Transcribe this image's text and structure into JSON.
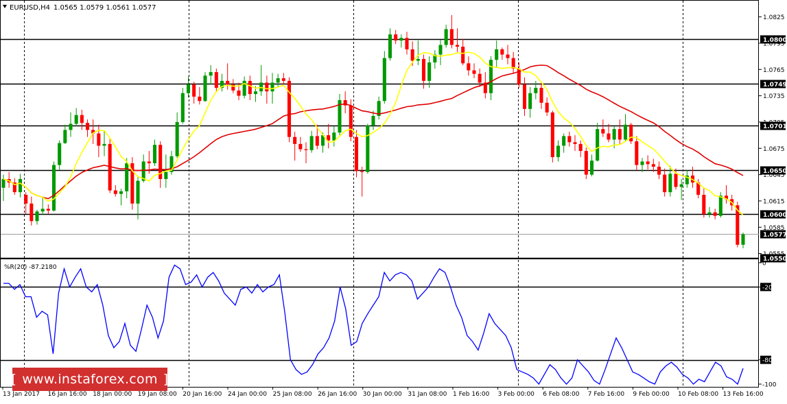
{
  "header": {
    "symbol": "EURUSD,H4",
    "ohlc": "1.0565 1.0579 1.0561 1.0577",
    "menu_icon": "triangle-down-icon"
  },
  "indicator": {
    "label": "%R(20) -87.2180"
  },
  "price_axis": {
    "ticks": [
      "1.0825",
      "1.0795",
      "1.0765",
      "1.0735",
      "1.0705",
      "1.0675",
      "1.0645",
      "1.0615",
      "1.0585",
      "1.0555"
    ],
    "levels": [
      {
        "label": "1.0800",
        "value": 1.08
      },
      {
        "label": "1.0749",
        "value": 1.0749
      },
      {
        "label": "1.0701",
        "value": 1.0701
      },
      {
        "label": "1.0650",
        "value": 1.065
      },
      {
        "label": "1.0600",
        "value": 1.06
      },
      {
        "label": "1.0577",
        "value": 1.0577
      },
      {
        "label": "1.0550",
        "value": 1.055
      }
    ]
  },
  "indicator_axis": {
    "ticks": [
      "0",
      "-20",
      "-80",
      "-100"
    ]
  },
  "time_axis": {
    "labels": [
      "13 Jan 2017",
      "16 Jan 16:00",
      "18 Jan 00:00",
      "19 Jan 08:00",
      "20 Jan 16:00",
      "24 Jan 00:00",
      "25 Jan 08:00",
      "26 Jan 16:00",
      "30 Jan 00:00",
      "31 Jan 08:00",
      "1 Feb 16:00",
      "3 Feb 00:00",
      "6 Feb 08:00",
      "7 Feb 16:00",
      "9 Feb 00:00",
      "10 Feb 08:00",
      "13 Feb 16:00"
    ]
  },
  "watermark": {
    "text": "www.instaforex.com",
    "left_bracket": "[",
    "right_bracket": "]"
  },
  "colors": {
    "bull": "#009900",
    "bear": "#ff0000",
    "ma_fast": "#ffff00",
    "ma_slow": "#e00000",
    "wpr": "#0000ff",
    "level_box": "#000000"
  },
  "chart_data": {
    "type": "candlestick",
    "timeframe": "H4",
    "ylim": [
      1.055,
      1.0835
    ],
    "wpr_ylim": [
      -100,
      0
    ],
    "wpr_levels": [
      -20,
      -80
    ],
    "candles": [
      [
        1.063,
        1.0645,
        1.0615,
        1.064
      ],
      [
        1.064,
        1.0648,
        1.063,
        1.0636
      ],
      [
        1.0636,
        1.0641,
        1.0622,
        1.0625
      ],
      [
        1.0625,
        1.0646,
        1.0619,
        1.064
      ],
      [
        1.0622,
        1.0625,
        1.06,
        1.0612
      ],
      [
        1.0612,
        1.062,
        1.0587,
        1.0592
      ],
      [
        1.0592,
        1.0605,
        1.0588,
        1.0603
      ],
      [
        1.0603,
        1.062,
        1.0599,
        1.0606
      ],
      [
        1.0606,
        1.0611,
        1.06,
        1.0604
      ],
      [
        1.0604,
        1.066,
        1.0603,
        1.0656
      ],
      [
        1.0656,
        1.0684,
        1.065,
        1.0681
      ],
      [
        1.0681,
        1.0702,
        1.068,
        1.0696
      ],
      [
        1.0696,
        1.0716,
        1.0688,
        1.0703
      ],
      [
        1.0703,
        1.0721,
        1.07,
        1.0713
      ],
      [
        1.0713,
        1.0719,
        1.0696,
        1.0704
      ],
      [
        1.0704,
        1.0708,
        1.0688,
        1.0696
      ],
      [
        1.0696,
        1.0708,
        1.068,
        1.0692
      ],
      [
        1.0692,
        1.0702,
        1.0665,
        1.0678
      ],
      [
        1.0678,
        1.0695,
        1.0666,
        1.068
      ],
      [
        1.068,
        1.0686,
        1.0624,
        1.0627
      ],
      [
        1.0627,
        1.0633,
        1.062,
        1.0623
      ],
      [
        1.0623,
        1.0629,
        1.061,
        1.0626
      ],
      [
        1.0626,
        1.0664,
        1.0618,
        1.0658
      ],
      [
        1.0658,
        1.0665,
        1.0605,
        1.0612
      ],
      [
        1.0612,
        1.0643,
        1.0594,
        1.0638
      ],
      [
        1.0638,
        1.0668,
        1.0636,
        1.066
      ],
      [
        1.066,
        1.0672,
        1.0646,
        1.0658
      ],
      [
        1.0658,
        1.0685,
        1.0655,
        1.0679
      ],
      [
        1.0679,
        1.0683,
        1.063,
        1.064
      ],
      [
        1.064,
        1.0668,
        1.063,
        1.0648
      ],
      [
        1.0648,
        1.0672,
        1.0645,
        1.0666
      ],
      [
        1.0666,
        1.0716,
        1.0664,
        1.0705
      ],
      [
        1.0705,
        1.0744,
        1.0703,
        1.0738
      ],
      [
        1.0738,
        1.0757,
        1.0733,
        1.0748
      ],
      [
        1.0748,
        1.0751,
        1.0726,
        1.0734
      ],
      [
        1.0734,
        1.0745,
        1.0725,
        1.0729
      ],
      [
        1.0729,
        1.0762,
        1.0728,
        1.0758
      ],
      [
        1.0758,
        1.077,
        1.0748,
        1.0762
      ],
      [
        1.0762,
        1.0766,
        1.074,
        1.0744
      ],
      [
        1.0744,
        1.076,
        1.074,
        1.0752
      ],
      [
        1.0752,
        1.0772,
        1.0742,
        1.0748
      ],
      [
        1.0748,
        1.0754,
        1.0738,
        1.0741
      ],
      [
        1.0741,
        1.075,
        1.073,
        1.0735
      ],
      [
        1.0735,
        1.0757,
        1.0732,
        1.0752
      ],
      [
        1.0752,
        1.0758,
        1.073,
        1.0737
      ],
      [
        1.0737,
        1.0746,
        1.0728,
        1.074
      ],
      [
        1.074,
        1.077,
        1.0735,
        1.075
      ],
      [
        1.075,
        1.0758,
        1.0726,
        1.074
      ],
      [
        1.074,
        1.0761,
        1.0726,
        1.075
      ],
      [
        1.075,
        1.076,
        1.0745,
        1.0755
      ],
      [
        1.0755,
        1.0761,
        1.0748,
        1.0752
      ],
      [
        1.0752,
        1.0756,
        1.0682,
        1.0688
      ],
      [
        1.0688,
        1.0694,
        1.0661,
        1.068
      ],
      [
        1.068,
        1.0688,
        1.0671,
        1.0674
      ],
      [
        1.0674,
        1.0682,
        1.0658,
        1.0673
      ],
      [
        1.0673,
        1.0695,
        1.067,
        1.0689
      ],
      [
        1.0689,
        1.0702,
        1.0674,
        1.0678
      ],
      [
        1.0678,
        1.0693,
        1.067,
        1.069
      ],
      [
        1.069,
        1.0703,
        1.0675,
        1.0684
      ],
      [
        1.0684,
        1.07,
        1.0677,
        1.0693
      ],
      [
        1.0693,
        1.0737,
        1.069,
        1.073
      ],
      [
        1.073,
        1.074,
        1.0715,
        1.0724
      ],
      [
        1.0724,
        1.0731,
        1.0683,
        1.0688
      ],
      [
        1.0688,
        1.0696,
        1.0642,
        1.0649
      ],
      [
        1.0649,
        1.0654,
        1.062,
        1.0648
      ],
      [
        1.0648,
        1.0703,
        1.0646,
        1.0701
      ],
      [
        1.0701,
        1.0718,
        1.0696,
        1.0712
      ],
      [
        1.0712,
        1.0734,
        1.0708,
        1.0729
      ],
      [
        1.0729,
        1.0786,
        1.0726,
        1.0778
      ],
      [
        1.0778,
        1.0812,
        1.0775,
        1.0805
      ],
      [
        1.0805,
        1.081,
        1.0794,
        1.0798
      ],
      [
        1.0798,
        1.0805,
        1.079,
        1.0801
      ],
      [
        1.0801,
        1.0808,
        1.0782,
        1.0788
      ],
      [
        1.0788,
        1.0797,
        1.0769,
        1.0775
      ],
      [
        1.0775,
        1.0798,
        1.077,
        1.0777
      ],
      [
        1.0777,
        1.0782,
        1.0743,
        1.0752
      ],
      [
        1.0752,
        1.078,
        1.0744,
        1.0773
      ],
      [
        1.0773,
        1.0787,
        1.0766,
        1.0782
      ],
      [
        1.0782,
        1.0799,
        1.077,
        1.0793
      ],
      [
        1.0793,
        1.0816,
        1.079,
        1.0811
      ],
      [
        1.0811,
        1.0827,
        1.0789,
        1.0793
      ],
      [
        1.0793,
        1.0812,
        1.0785,
        1.0791
      ],
      [
        1.0791,
        1.08,
        1.077,
        1.0772
      ],
      [
        1.0772,
        1.078,
        1.0758,
        1.0764
      ],
      [
        1.0764,
        1.0772,
        1.0755,
        1.076
      ],
      [
        1.076,
        1.0766,
        1.0745,
        1.075
      ],
      [
        1.075,
        1.0762,
        1.0732,
        1.0738
      ],
      [
        1.0738,
        1.078,
        1.073,
        1.0776
      ],
      [
        1.0776,
        1.0798,
        1.0767,
        1.0788
      ],
      [
        1.0788,
        1.079,
        1.0776,
        1.0782
      ],
      [
        1.0782,
        1.0793,
        1.0771,
        1.0778
      ],
      [
        1.0778,
        1.0785,
        1.076,
        1.0766
      ],
      [
        1.0766,
        1.0773,
        1.0744,
        1.0748
      ],
      [
        1.0748,
        1.0756,
        1.0712,
        1.072
      ],
      [
        1.072,
        1.0745,
        1.071,
        1.0738
      ],
      [
        1.0738,
        1.0752,
        1.0731,
        1.0744
      ],
      [
        1.0744,
        1.075,
        1.072,
        1.0727
      ],
      [
        1.0727,
        1.0733,
        1.0712,
        1.0716
      ],
      [
        1.0716,
        1.0718,
        1.0659,
        1.0665
      ],
      [
        1.0665,
        1.0684,
        1.066,
        1.0678
      ],
      [
        1.0678,
        1.0692,
        1.067,
        1.0689
      ],
      [
        1.0689,
        1.0694,
        1.0677,
        1.0682
      ],
      [
        1.0682,
        1.069,
        1.0672,
        1.068
      ],
      [
        1.068,
        1.0684,
        1.0665,
        1.0672
      ],
      [
        1.0672,
        1.0676,
        1.064,
        1.0645
      ],
      [
        1.0645,
        1.0668,
        1.0643,
        1.0661
      ],
      [
        1.0661,
        1.0704,
        1.066,
        1.0697
      ],
      [
        1.0697,
        1.0708,
        1.0688,
        1.0692
      ],
      [
        1.0692,
        1.0703,
        1.0682,
        1.0685
      ],
      [
        1.0685,
        1.07,
        1.0675,
        1.0697
      ],
      [
        1.0697,
        1.0708,
        1.068,
        1.0685
      ],
      [
        1.0685,
        1.0714,
        1.0683,
        1.0702
      ],
      [
        1.0702,
        1.0704,
        1.068,
        1.0683
      ],
      [
        1.0683,
        1.0689,
        1.065,
        1.0656
      ],
      [
        1.0656,
        1.0664,
        1.0648,
        1.066
      ],
      [
        1.066,
        1.0667,
        1.0651,
        1.0657
      ],
      [
        1.0657,
        1.0663,
        1.0648,
        1.0654
      ],
      [
        1.0654,
        1.066,
        1.064,
        1.0645
      ],
      [
        1.0645,
        1.0652,
        1.062,
        1.0625
      ],
      [
        1.0625,
        1.0655,
        1.062,
        1.0646
      ],
      [
        1.0646,
        1.0652,
        1.0628,
        1.0631
      ],
      [
        1.0631,
        1.064,
        1.0616,
        1.0634
      ],
      [
        1.0634,
        1.065,
        1.063,
        1.0644
      ],
      [
        1.0644,
        1.0654,
        1.063,
        1.0636
      ],
      [
        1.0636,
        1.064,
        1.0618,
        1.0622
      ],
      [
        1.0622,
        1.063,
        1.0596,
        1.06
      ],
      [
        1.06,
        1.0608,
        1.0596,
        1.0602
      ],
      [
        1.0602,
        1.0606,
        1.0594,
        1.0598
      ],
      [
        1.0598,
        1.0625,
        1.0596,
        1.0621
      ],
      [
        1.0621,
        1.0633,
        1.0612,
        1.0617
      ],
      [
        1.0617,
        1.0622,
        1.0604,
        1.061
      ],
      [
        1.061,
        1.0614,
        1.0562,
        1.0565
      ],
      [
        1.0565,
        1.0579,
        1.0561,
        1.0577
      ]
    ],
    "ma_fast_visible": true,
    "ma_slow_visible": true,
    "wpr": [
      -17,
      -17,
      -22,
      -18,
      -28,
      -28,
      -45,
      -40,
      -43,
      -75,
      -25,
      -5,
      -20,
      -12,
      -5,
      -20,
      -24,
      -18,
      -35,
      -60,
      -70,
      -65,
      -50,
      -68,
      -73,
      -55,
      -35,
      -45,
      -62,
      -48,
      -12,
      -2,
      -5,
      -18,
      -16,
      -10,
      -20,
      -12,
      -8,
      -15,
      -25,
      -30,
      -35,
      -22,
      -20,
      -25,
      -18,
      -24,
      -20,
      -18,
      -10,
      -42,
      -80,
      -88,
      -92,
      -90,
      -84,
      -75,
      -70,
      -62,
      -48,
      -20,
      -38,
      -68,
      -65,
      -50,
      -42,
      -35,
      -28,
      -8,
      -15,
      -10,
      -8,
      -10,
      -15,
      -30,
      -25,
      -20,
      -12,
      -5,
      -8,
      -20,
      -35,
      -45,
      -60,
      -65,
      -72,
      -58,
      -42,
      -50,
      -55,
      -60,
      -70,
      -88,
      -90,
      -92,
      -95,
      -100,
      -92,
      -84,
      -88,
      -95,
      -100,
      -95,
      -80,
      -85,
      -90,
      -97,
      -100,
      -88,
      -75,
      -62,
      -70,
      -80,
      -90,
      -92,
      -95,
      -98,
      -100,
      -90,
      -85,
      -82,
      -86,
      -92,
      -95,
      -100,
      -96,
      -98,
      -90,
      -82,
      -85,
      -94,
      -96,
      -100,
      -87
    ]
  }
}
